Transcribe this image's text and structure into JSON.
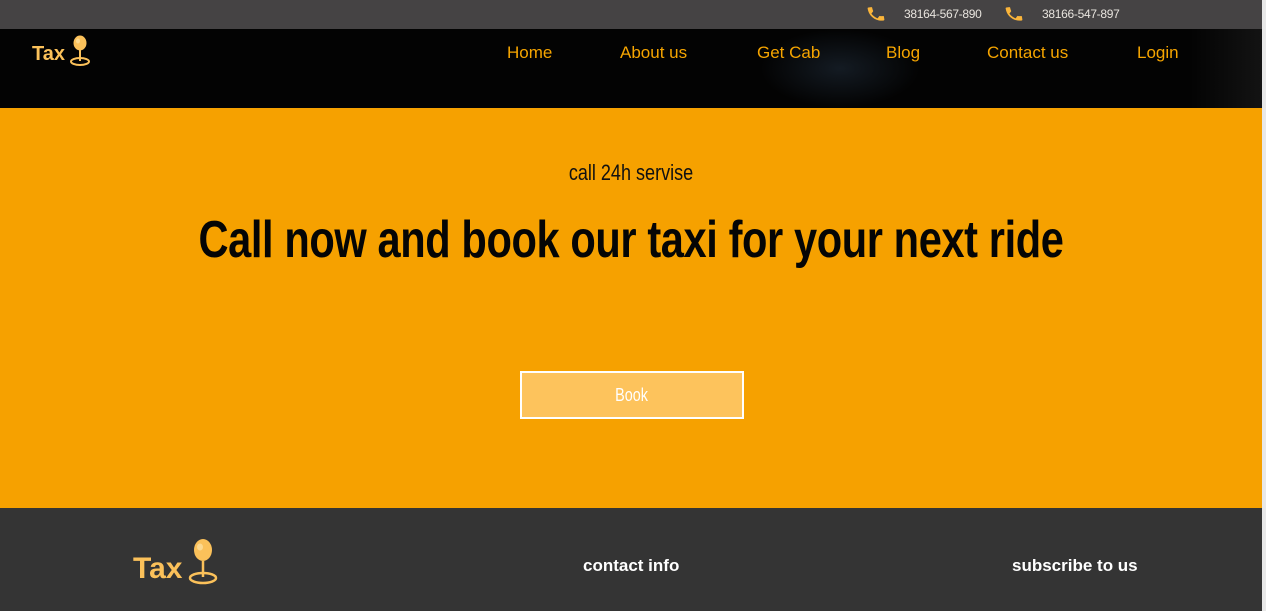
{
  "topbar": {
    "phones": [
      {
        "icon": "phone-icon",
        "number": "38164-567-890"
      },
      {
        "icon": "phone-icon",
        "number": "38166-547-897"
      }
    ]
  },
  "brand": {
    "name": "Tax",
    "icon": "map-pin-icon",
    "color": "#fbc15a"
  },
  "nav": {
    "items": [
      {
        "label": "Home"
      },
      {
        "label": "About us"
      },
      {
        "label": "Get Cab"
      },
      {
        "label": "Blog"
      },
      {
        "label": "Contact us"
      },
      {
        "label": "Login"
      }
    ],
    "color": "#f6a500"
  },
  "hero": {
    "subtitle": "call 24h servise",
    "title": "Call now and book our taxi for your next ride",
    "button_label": "Book",
    "background": "#f6a100"
  },
  "footer": {
    "brand": "Tax",
    "contact_heading": "contact info",
    "subscribe_heading": "subscribe to us"
  }
}
